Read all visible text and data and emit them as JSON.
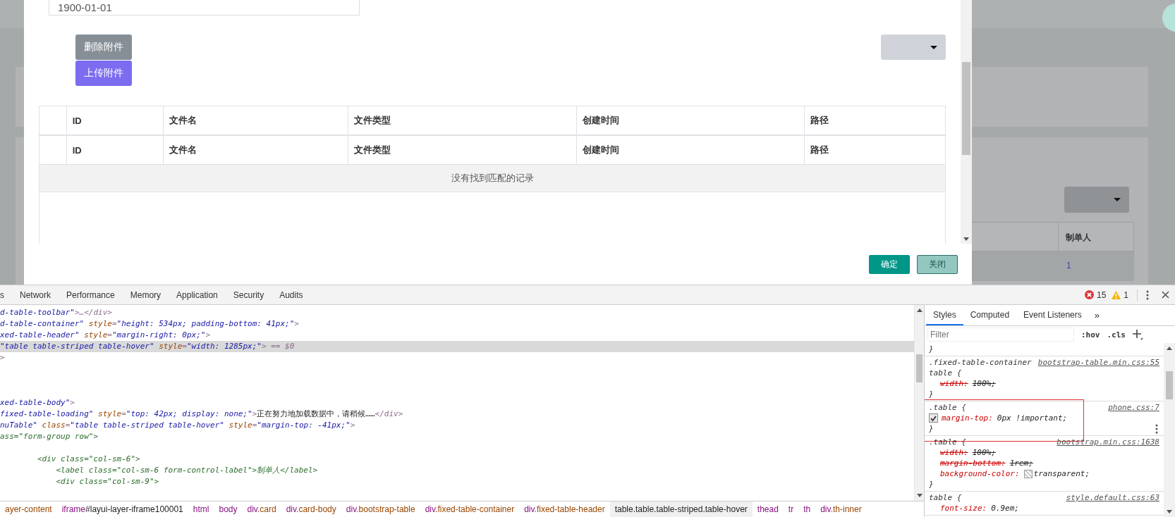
{
  "background_page": {
    "table_header": "制单人",
    "table_cell": "1"
  },
  "modal": {
    "date_field": {
      "value": "1900-01-01"
    },
    "buttons": [
      {
        "label": "删除附件",
        "kind": "secondary"
      },
      {
        "label": "上传附件",
        "kind": "primary"
      }
    ],
    "table": {
      "header_rows": [
        {
          "cells": [
            "ID",
            "文件名",
            "文件类型",
            "创建时间",
            "路径"
          ]
        },
        {
          "cells": [
            "ID",
            "文件名",
            "文件类型",
            "创建时间",
            "路径"
          ]
        }
      ],
      "empty_message": "没有找到匹配的记录"
    },
    "footer_buttons": [
      {
        "label": "确定",
        "kind": "primary"
      },
      {
        "label": "关闭",
        "kind": "secondary"
      }
    ]
  },
  "devtools": {
    "tabs": [
      {
        "label": "s",
        "selected": false
      },
      {
        "label": "Network",
        "selected": false
      },
      {
        "label": "Performance",
        "selected": false
      },
      {
        "label": "Memory",
        "selected": false
      },
      {
        "label": "Application",
        "selected": false
      },
      {
        "label": "Security",
        "selected": false
      },
      {
        "label": "Audits",
        "selected": false
      }
    ],
    "errors": "15",
    "warnings": "1",
    "elements": {
      "lines": [
        {
          "kind": "code",
          "selected": false,
          "tokens": [
            {
              "kind": "value",
              "text": "d-table-toolbar\""
            },
            {
              "kind": "punct",
              "text": ">…</div>"
            }
          ]
        },
        {
          "kind": "code",
          "selected": false,
          "tokens": [
            {
              "kind": "value",
              "text": "d-table-container\""
            },
            {
              "kind": "attr",
              "text": " style"
            },
            {
              "kind": "punct",
              "text": "="
            },
            {
              "kind": "value",
              "text": "\"height: 534px; padding-bottom: 41px;\""
            },
            {
              "kind": "punct",
              "text": ">"
            }
          ]
        },
        {
          "kind": "code",
          "selected": false,
          "tokens": [
            {
              "kind": "value",
              "text": "xed-table-header\""
            },
            {
              "kind": "attr",
              "text": " style"
            },
            {
              "kind": "punct",
              "text": "="
            },
            {
              "kind": "value",
              "text": "\"margin-right: 0px;\""
            },
            {
              "kind": "punct",
              "text": ">"
            }
          ]
        },
        {
          "kind": "code",
          "selected": true,
          "tokens": [
            {
              "kind": "value",
              "text": "\"table table-striped table-hover\""
            },
            {
              "kind": "attr",
              "text": " style"
            },
            {
              "kind": "punct",
              "text": "="
            },
            {
              "kind": "value",
              "text": "\"width: 1285px;\""
            },
            {
              "kind": "punct",
              "text": "> == $0"
            }
          ]
        },
        {
          "kind": "code",
          "selected": false,
          "tokens": [
            {
              "kind": "punct",
              "text": ">"
            }
          ]
        },
        {
          "kind": "blank",
          "selected": false
        },
        {
          "kind": "blank",
          "selected": false
        },
        {
          "kind": "blank",
          "selected": false
        },
        {
          "kind": "code",
          "selected": false,
          "tokens": [
            {
              "kind": "value",
              "text": "xed-table-body\""
            },
            {
              "kind": "punct",
              "text": ">"
            }
          ]
        },
        {
          "kind": "code",
          "selected": false,
          "tokens": [
            {
              "kind": "value",
              "text": "fixed-table-loading\""
            },
            {
              "kind": "attr",
              "text": " style"
            },
            {
              "kind": "punct",
              "text": "="
            },
            {
              "kind": "value",
              "text": "\"top: 42px; display: none;\""
            },
            {
              "kind": "punct",
              "text": ">"
            },
            {
              "kind": "text",
              "text": "正在努力地加载数据中，请稍候……"
            },
            {
              "kind": "punct",
              "text": "</div>"
            }
          ]
        },
        {
          "kind": "code",
          "selected": false,
          "tokens": [
            {
              "kind": "value",
              "text": "nuTable\""
            },
            {
              "kind": "attr",
              "text": " class"
            },
            {
              "kind": "punct",
              "text": "="
            },
            {
              "kind": "value",
              "text": "\"table table-striped table-hover\""
            },
            {
              "kind": "attr",
              "text": " style"
            },
            {
              "kind": "punct",
              "text": "="
            },
            {
              "kind": "value",
              "text": "\"margin-top: -41px;\""
            },
            {
              "kind": "punct",
              "text": ">"
            }
          ]
        },
        {
          "kind": "code",
          "selected": false,
          "tokens": [
            {
              "kind": "script",
              "text": "ass=\"form-group row\">"
            }
          ]
        },
        {
          "kind": "blank",
          "selected": false
        },
        {
          "kind": "code",
          "selected": false,
          "tokens": [
            {
              "kind": "script",
              "text": "        <div class=\"col-sm-6\">"
            }
          ]
        },
        {
          "kind": "code",
          "selected": false,
          "tokens": [
            {
              "kind": "script",
              "text": "            <label class=\"col-sm-6 form-control-label\">制单人</label>"
            }
          ]
        },
        {
          "kind": "code",
          "selected": false,
          "tokens": [
            {
              "kind": "script",
              "text": "            <div class=\"col-sm-9\">"
            }
          ]
        }
      ]
    },
    "breadcrumbs": [
      {
        "classes": "ayer-content",
        "selected": false
      },
      {
        "tag": "iframe",
        "id": "#layui-layer-iframe100001",
        "selected": false
      },
      {
        "tag": "html",
        "selected": false
      },
      {
        "tag": "body",
        "selected": false
      },
      {
        "tag": "div",
        "classes": ".card",
        "selected": false
      },
      {
        "tag": "div",
        "classes": ".card-body",
        "selected": false
      },
      {
        "tag": "div",
        "classes": ".bootstrap-table",
        "selected": false
      },
      {
        "tag": "div",
        "classes": ".fixed-table-container",
        "selected": false
      },
      {
        "tag": "div",
        "classes": ".fixed-table-header",
        "selected": false
      },
      {
        "tag": "table",
        "classes": ".table.table-striped.table-hover",
        "selected": true
      },
      {
        "tag": "thead",
        "selected": false
      },
      {
        "tag": "tr",
        "selected": false
      },
      {
        "tag": "th",
        "selected": false
      },
      {
        "tag": "div",
        "classes": ".th-inner",
        "selected": false
      }
    ],
    "styles": {
      "tabs": [
        {
          "label": "Styles",
          "selected": true
        },
        {
          "label": "Computed",
          "selected": false
        },
        {
          "label": "Event Listeners",
          "selected": false
        }
      ],
      "more_tabs": "»",
      "filter": {
        "placeholder": "Filter"
      },
      "hov": ":hov",
      "cls": ".cls",
      "rules": [
        {
          "close": "}",
          "highlighted": false,
          "hovered": false
        },
        {
          "selector": [
            ".fixed-table-container",
            "table {"
          ],
          "source": "bootstrap-table.min.css:55",
          "declarations": [
            {
              "property": "width:",
              "value": "100%;",
              "overridden": true,
              "enabled": true
            }
          ],
          "close": "}",
          "highlighted": false,
          "hovered": false
        },
        {
          "selector": [
            ".table {"
          ],
          "source": "phone.css:7",
          "declarations": [
            {
              "property": "margin-top:",
              "value": "0px !important;",
              "overridden": false,
              "enabled": true
            }
          ],
          "close": "}",
          "highlighted": true,
          "hovered": true
        },
        {
          "selector": [
            ".table {"
          ],
          "source": "bootstrap.min.css:1638",
          "declarations": [
            {
              "property": "width:",
              "value": "100%;",
              "overridden": true,
              "enabled": true
            },
            {
              "property": "margin-bottom:",
              "value": "1rem;",
              "overridden": true,
              "enabled": true
            },
            {
              "property": "background-color:",
              "value": "transparent;",
              "overridden": false,
              "enabled": true,
              "swatch": true
            }
          ],
          "close": "}",
          "highlighted": false,
          "hovered": false
        },
        {
          "selector": [
            "table {"
          ],
          "source": "style.default.css:63",
          "declarations": [
            {
              "property": "font-size:",
              "value": "0.9em;",
              "overridden": false,
              "enabled": true
            }
          ],
          "highlighted": false,
          "hovered": false
        }
      ]
    }
  }
}
